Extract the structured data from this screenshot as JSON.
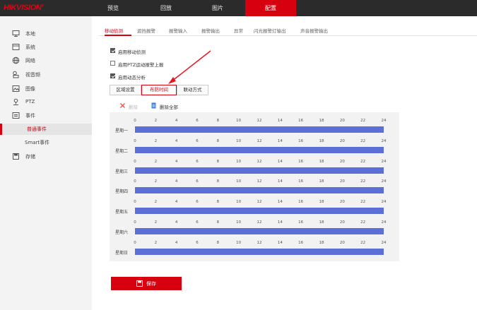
{
  "logo": {
    "text": "HIKVISION",
    "mark": "®"
  },
  "nav": [
    {
      "label": "预览"
    },
    {
      "label": "回放"
    },
    {
      "label": "图片"
    },
    {
      "label": "配置"
    }
  ],
  "sidebar": {
    "items": [
      {
        "label": "本地",
        "icon": "monitor-icon"
      },
      {
        "label": "系统",
        "icon": "system-icon"
      },
      {
        "label": "网络",
        "icon": "network-icon"
      },
      {
        "label": "视音频",
        "icon": "video-audio-icon"
      },
      {
        "label": "图像",
        "icon": "image-icon"
      },
      {
        "label": "PTZ",
        "icon": "ptz-icon"
      },
      {
        "label": "事件",
        "icon": "event-icon"
      },
      {
        "label": "普通事件"
      },
      {
        "label": "Smart事件"
      },
      {
        "label": "存储",
        "icon": "storage-icon"
      }
    ]
  },
  "subtabs": [
    "移动侦测",
    "遮挡报警",
    "报警输入",
    "报警输出",
    "异常",
    "闪光报警灯输出",
    "声音报警输出"
  ],
  "checkboxes": [
    {
      "label": "启用移动侦测",
      "checked": true
    },
    {
      "label": "启用PTZ运动报警上报",
      "checked": false
    },
    {
      "label": "启用动态分析",
      "checked": true
    }
  ],
  "section_tabs": [
    "区域设置",
    "布防时间",
    "联动方式"
  ],
  "toolbar": {
    "delete": "删除",
    "delete_all": "删除全部"
  },
  "schedule": {
    "hours": [
      "0",
      "2",
      "4",
      "6",
      "8",
      "10",
      "12",
      "14",
      "16",
      "18",
      "20",
      "22",
      "24"
    ],
    "days": [
      "星期一",
      "星期二",
      "星期三",
      "星期四",
      "星期五",
      "星期六",
      "星期日"
    ],
    "bar_color": "#5b6fd6"
  },
  "save": "保存",
  "colors": {
    "accent": "#d7000f",
    "topbar": "#2b2b2b"
  }
}
